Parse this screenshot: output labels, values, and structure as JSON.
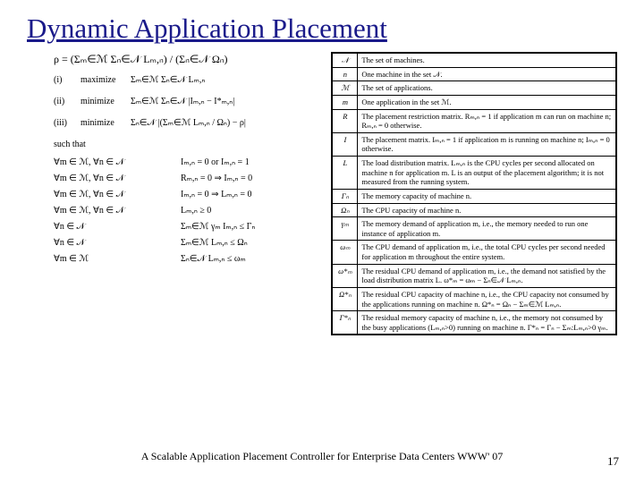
{
  "title": "Dynamic Application Placement",
  "rho": "ρ = (Σₘ∈ℳ Σₙ∈𝒩 Lₘ,ₙ) / (Σₙ∈𝒩 Ωₙ)",
  "objectives": [
    {
      "num": "(i)",
      "verb": "maximize",
      "expr": "Σₘ∈ℳ Σₙ∈𝒩 Lₘ,ₙ"
    },
    {
      "num": "(ii)",
      "verb": "minimize",
      "expr": "Σₘ∈ℳ Σₙ∈𝒩 |Iₘ,ₙ − I*ₘ,ₙ|"
    },
    {
      "num": "(iii)",
      "verb": "minimize",
      "expr": "Σₙ∈𝒩 |(Σₘ∈ℳ Lₘ,ₙ / Ωₙ) − ρ|"
    }
  ],
  "such_that": "such that",
  "constraints": [
    {
      "q": "∀m ∈ ℳ, ∀n ∈ 𝒩",
      "r": "Iₘ,ₙ = 0  or  Iₘ,ₙ = 1"
    },
    {
      "q": "∀m ∈ ℳ, ∀n ∈ 𝒩",
      "r": "Rₘ,ₙ = 0 ⇒ Iₘ,ₙ = 0"
    },
    {
      "q": "∀m ∈ ℳ, ∀n ∈ 𝒩",
      "r": "Iₘ,ₙ = 0 ⇒ Lₘ,ₙ = 0"
    },
    {
      "q": "∀m ∈ ℳ, ∀n ∈ 𝒩",
      "r": "Lₘ,ₙ ≥ 0"
    },
    {
      "q": "∀n ∈ 𝒩",
      "r": "Σₘ∈ℳ γₘ Iₘ,ₙ ≤ Γₙ"
    },
    {
      "q": "∀n ∈ 𝒩",
      "r": "Σₘ∈ℳ Lₘ,ₙ ≤ Ωₙ"
    },
    {
      "q": "∀m ∈ ℳ",
      "r": "Σₙ∈𝒩 Lₘ,ₙ ≤ ωₘ"
    }
  ],
  "symbols": [
    {
      "s": "𝒩",
      "d": "The set of machines."
    },
    {
      "s": "n",
      "d": "One machine in the set 𝒩."
    },
    {
      "s": "ℳ",
      "d": "The set of applications."
    },
    {
      "s": "m",
      "d": "One application in the set ℳ."
    },
    {
      "s": "R",
      "d": "The placement restriction matrix. Rₘ,ₙ = 1 if application m can run on machine n; Rₘ,ₙ = 0 otherwise."
    },
    {
      "s": "I",
      "d": "The placement matrix. Iₘ,ₙ = 1 if application m is running on machine n; Iₘ,ₙ = 0 otherwise."
    },
    {
      "s": "L",
      "d": "The load distribution matrix. Lₘ,ₙ is the CPU cycles per second allocated on machine n for application m. L is an output of the placement algorithm; it is not measured from the running system."
    },
    {
      "s": "Γₙ",
      "d": "The memory capacity of machine n."
    },
    {
      "s": "Ωₙ",
      "d": "The CPU capacity of machine n."
    },
    {
      "s": "γₘ",
      "d": "The memory demand of application m, i.e., the memory needed to run one instance of application m."
    },
    {
      "s": "ωₘ",
      "d": "The CPU demand of application m, i.e., the total CPU cycles per second needed for application m throughout the entire system."
    },
    {
      "s": "ω*ₘ",
      "d": "The residual CPU demand of application m, i.e., the demand not satisfied by the load distribution matrix L. ω*ₘ = ωₘ − Σₙ∈𝒩 Lₘ,ₙ."
    },
    {
      "s": "Ω*ₙ",
      "d": "The residual CPU capacity of machine n, i.e., the CPU capacity not consumed by the applications running on machine n. Ω*ₙ = Ωₙ − Σₘ∈ℳ Lₘ,ₙ."
    },
    {
      "s": "Γ*ₙ",
      "d": "The residual memory capacity of machine n, i.e., the memory not consumed by the busy applications (Lₘ,ₙ>0) running on machine n. Γ*ₙ = Γₙ − Σₘ:Lₘ,ₙ>0 γₘ."
    }
  ],
  "caption": "A Scalable Application Placement Controller for Enterprise Data Centers  WWW' 07",
  "pagenum": "17"
}
